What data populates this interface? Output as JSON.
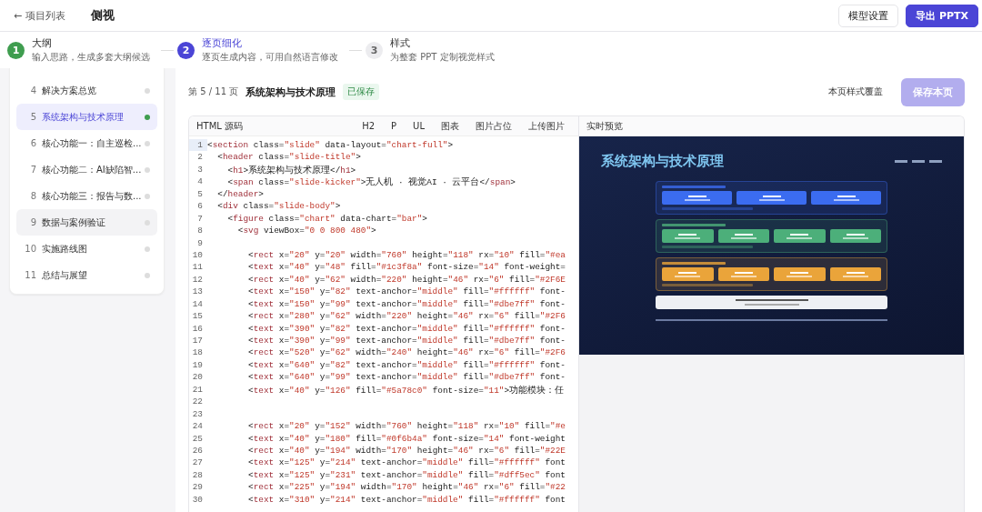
{
  "topbar": {
    "back": "← 项目列表",
    "project": "侧视",
    "buttons": [
      {
        "label": "模型设置",
        "kind": "secondary"
      },
      {
        "label": "导出 PPTX",
        "kind": "primary"
      }
    ]
  },
  "steps": [
    {
      "number": "1",
      "title": "大纲",
      "desc": "输入思路，生成多套大纲候选",
      "completed": true,
      "selected": false
    },
    {
      "number": "2",
      "title": "逐页细化",
      "desc": "逐页生成内容，可用自然语言修改",
      "completed": false,
      "selected": true
    },
    {
      "number": "3",
      "title": "样式",
      "desc": "为整套 PPT 定制视觉样式",
      "completed": false,
      "selected": false
    }
  ],
  "pages": [
    {
      "number": "4",
      "title": "解决方案总览",
      "selected": false,
      "saved": false
    },
    {
      "number": "5",
      "title": "系统架构与技术原理",
      "selected": true,
      "saved": true
    },
    {
      "number": "6",
      "title": "核心功能一：自主巡检...",
      "selected": false,
      "saved": false
    },
    {
      "number": "7",
      "title": "核心功能二：AI缺陷智...",
      "selected": false,
      "saved": false
    },
    {
      "number": "8",
      "title": "核心功能三：报告与数...",
      "selected": false,
      "saved": false
    },
    {
      "number": "9",
      "title": "数据与案例验证",
      "selected": false,
      "hovered": true,
      "saved": false
    },
    {
      "number": "10",
      "title": "实施路线图",
      "selected": false,
      "saved": false
    },
    {
      "number": "11",
      "title": "总结与展望",
      "selected": false,
      "saved": false
    }
  ],
  "editor": {
    "counter": "第 5 / 11 页",
    "title": "系统架构与技术原理",
    "status": "已保存",
    "override": "本页样式覆盖",
    "save": "保存本页",
    "save_disabled": true,
    "source_label": "HTML 源码",
    "tools": [
      "H2",
      "P",
      "UL",
      "图表",
      "图片占位",
      "上传图片"
    ],
    "preview_label": "实时预览",
    "code": [
      {
        "no": "1",
        "text": "<section class=\"slide\" data-layout=\"chart-full\">"
      },
      {
        "no": "2",
        "text": "  <header class=\"slide-title\">"
      },
      {
        "no": "3",
        "text": "    <h1>系统架构与技术原理</h1>"
      },
      {
        "no": "4",
        "text": "    <span class=\"slide-kicker\">无人机 · 视觉AI · 云平台</span>"
      },
      {
        "no": "5",
        "text": "  </header>"
      },
      {
        "no": "6",
        "text": "  <div class=\"slide-body\">"
      },
      {
        "no": "7",
        "text": "    <figure class=\"chart\" data-chart=\"bar\">"
      },
      {
        "no": "8",
        "text": "      <svg viewBox=\"0 0 800 480\">"
      },
      {
        "no": "9"
      },
      {
        "no": "10",
        "text": "        <rect x=\"20\" y=\"20\" width=\"760\" height=\"118\" rx=\"10\" fill=\"#ea"
      },
      {
        "no": "11",
        "text": "        <text x=\"40\" y=\"48\" fill=\"#1c3f8a\" font-size=\"14\" font-weight="
      },
      {
        "no": "12",
        "text": "        <rect x=\"40\" y=\"62\" width=\"220\" height=\"46\" rx=\"6\" fill=\"#2F6E"
      },
      {
        "no": "13",
        "text": "        <text x=\"150\" y=\"82\" text-anchor=\"middle\" fill=\"#ffffff\" font-"
      },
      {
        "no": "14",
        "text": "        <text x=\"150\" y=\"99\" text-anchor=\"middle\" fill=\"#dbe7ff\" font-"
      },
      {
        "no": "15",
        "text": "        <rect x=\"280\" y=\"62\" width=\"220\" height=\"46\" rx=\"6\" fill=\"#2F6"
      },
      {
        "no": "16",
        "text": "        <text x=\"390\" y=\"82\" text-anchor=\"middle\" fill=\"#ffffff\" font-"
      },
      {
        "no": "17",
        "text": "        <text x=\"390\" y=\"99\" text-anchor=\"middle\" fill=\"#dbe7ff\" font-"
      },
      {
        "no": "18",
        "text": "        <rect x=\"520\" y=\"62\" width=\"240\" height=\"46\" rx=\"6\" fill=\"#2F6"
      },
      {
        "no": "19",
        "text": "        <text x=\"640\" y=\"82\" text-anchor=\"middle\" fill=\"#ffffff\" font-"
      },
      {
        "no": "20",
        "text": "        <text x=\"640\" y=\"99\" text-anchor=\"middle\" fill=\"#dbe7ff\" font-"
      },
      {
        "no": "21",
        "text": "        <text x=\"40\" y=\"126\" fill=\"#5a78c0\" font-size=\"11\">功能模块：任"
      },
      {
        "no": "22"
      },
      {
        "no": "23"
      },
      {
        "no": "24",
        "text": "        <rect x=\"20\" y=\"152\" width=\"760\" height=\"118\" rx=\"10\" fill=\"#e"
      },
      {
        "no": "25",
        "text": "        <text x=\"40\" y=\"180\" fill=\"#0f6b4a\" font-size=\"14\" font-weight"
      },
      {
        "no": "26",
        "text": "        <rect x=\"40\" y=\"194\" width=\"170\" height=\"46\" rx=\"6\" fill=\"#22E"
      },
      {
        "no": "27",
        "text": "        <text x=\"125\" y=\"214\" text-anchor=\"middle\" fill=\"#ffffff\" font"
      },
      {
        "no": "28",
        "text": "        <text x=\"125\" y=\"231\" text-anchor=\"middle\" fill=\"#dff5ec\" font"
      },
      {
        "no": "29",
        "text": "        <rect x=\"225\" y=\"194\" width=\"170\" height=\"46\" rx=\"6\" fill=\"#22"
      },
      {
        "no": "30",
        "text": "        <text x=\"310\" y=\"214\" text-anchor=\"middle\" fill=\"#ffffff\" font"
      }
    ]
  },
  "preview": {
    "title": "系统架构与技术原理",
    "layers": [
      {
        "color": "#3b6cf0"
      },
      {
        "color": "#4caf7a"
      },
      {
        "color": "#eaa43a"
      }
    ]
  }
}
